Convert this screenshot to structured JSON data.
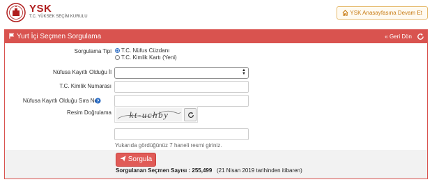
{
  "header": {
    "logo_text": "YSK",
    "logo_subtitle": "T.C. YÜKSEK SEÇİM KURULU",
    "home_button_label": "YSK Anasayfasına Devam Et"
  },
  "panel": {
    "title": "Yurt İçi Seçmen Sorgulama",
    "back_label": "Geri Dön"
  },
  "form": {
    "query_type_label": "Sorgulama Tipi",
    "query_type_options": [
      "T.C. Nüfus Cüzdanı",
      "T.C. Kimlik Kartı (Yeni)"
    ],
    "selected_query_type": "T.C. Nüfus Cüzdanı",
    "province_label": "Nüfusa Kayıtlı Olduğu İl",
    "province_value": "",
    "tc_label": "T.C. Kimlik Numarası",
    "tc_value": "",
    "order_no_label": "Nüfusa Kayıtlı Olduğu Sıra No",
    "order_no_value": "",
    "captcha_label": "Resim Doğrulama",
    "captcha_text": "kt-uchby",
    "captcha_input_value": "",
    "captcha_hint": "Yukarıda gördüğünüz 7 haneli resmi giriniz."
  },
  "submit": {
    "label": "Sorgula"
  },
  "stats": {
    "label": "Sorgulanan Seçmen Sayısı :",
    "count": "255,499",
    "since": "(21 Nisan 2019 tarihinden itibaren)"
  },
  "colors": {
    "primary_red": "#d9534f",
    "home_button": "#c77a12",
    "radio_accent": "#2a6cc4"
  }
}
